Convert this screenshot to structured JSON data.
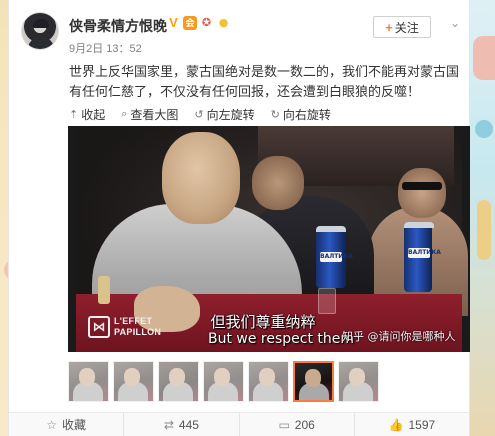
{
  "post": {
    "author": "侠骨柔情方恨晚",
    "time": "9月2日 13：52",
    "follow_label": "关注",
    "more_label": "⌄",
    "text": "世界上反华国家里，蒙古国绝对是数一数二的，我们不能再对蒙古国有任何仁慈了，不仅没有任何回报，还会遭到白眼狼的反噬！",
    "badges": [
      "V",
      "会",
      "勋",
      "灯"
    ]
  },
  "toolbar": {
    "collapse": "收起",
    "view_large": "查看大图",
    "rotate_left": "向左旋转",
    "rotate_right": "向右旋转"
  },
  "media": {
    "subtitle_cn": "但我们尊重纳粹",
    "subtitle_en": "But we respect them",
    "logo_line1": "L'EFFET",
    "logo_line2": "PAPILLON",
    "watermark": "知乎 @请问你是哪种人",
    "can_label": "ВАЛТИКА"
  },
  "thumbnails": {
    "count": 7,
    "active_index": 5
  },
  "footer": {
    "favorite": "收藏",
    "repost_count": "445",
    "comment_count": "206",
    "like_count": "1597"
  },
  "colors": {
    "accent": "#fa7d3c",
    "text": "#333333",
    "muted": "#808080"
  }
}
